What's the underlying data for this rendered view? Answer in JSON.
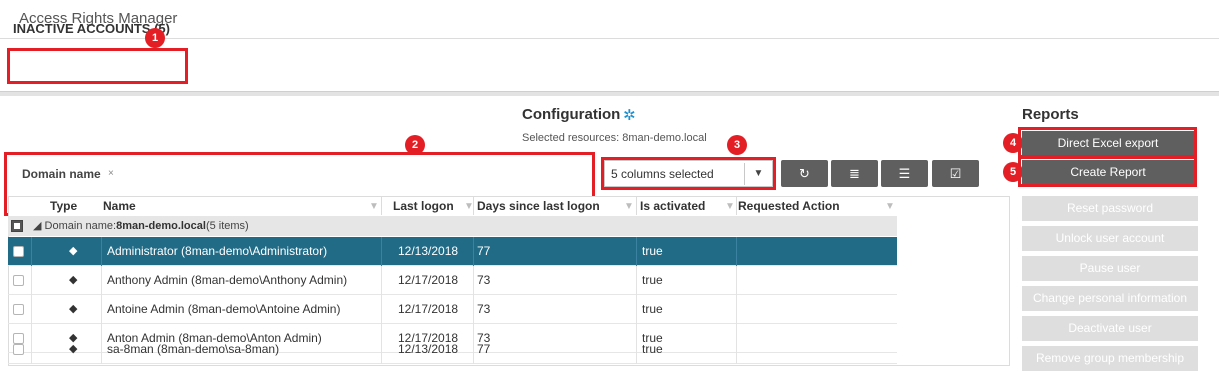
{
  "app": {
    "title": "Access Rights Manager"
  },
  "page": {
    "title": "INACTIVE ACCOUNTS (5)"
  },
  "badges": [
    "1",
    "2",
    "3",
    "4",
    "5"
  ],
  "configuration": {
    "title": "Configuration",
    "selected_resources": "Selected resources: 8man-demo.local",
    "gear_icon": "gear-icon"
  },
  "grouping": {
    "chip_label": "Domain name",
    "chip_remove": "×"
  },
  "columns_select": {
    "value": "5 columns selected",
    "caret": "▼"
  },
  "toolbar": [
    {
      "name": "refresh-icon",
      "glyph": "↻"
    },
    {
      "name": "list-icon",
      "glyph": "≣"
    },
    {
      "name": "align-icon",
      "glyph": "☰"
    },
    {
      "name": "check-square-icon",
      "glyph": "☑"
    }
  ],
  "reports": {
    "title": "Reports",
    "direct_excel_export": "Direct Excel export",
    "create_report": "Create Report"
  },
  "actions": [
    "Reset password",
    "Unlock user account",
    "Pause user",
    "Change personal information",
    "Deactivate user",
    "Remove group membership"
  ],
  "table": {
    "headers": {
      "type": "Type",
      "name": "Name",
      "last_logon": "Last logon",
      "days_since": "Days since last logon",
      "is_activated": "Is activated",
      "requested_action": "Requested Action"
    },
    "group": {
      "prefix": "Domain name:",
      "value": "8man-demo.local",
      "suffix": "(5 items)"
    },
    "rows": [
      {
        "name": "Administrator (8man-demo\\Administrator)",
        "last_logon": "12/13/2018",
        "days": "77",
        "activated": "true",
        "selected": true
      },
      {
        "name": "Anthony Admin (8man-demo\\Anthony Admin)",
        "last_logon": "12/17/2018",
        "days": "73",
        "activated": "true",
        "selected": false
      },
      {
        "name": "Antoine Admin (8man-demo\\Antoine Admin)",
        "last_logon": "12/17/2018",
        "days": "73",
        "activated": "true",
        "selected": false
      },
      {
        "name": "Anton Admin (8man-demo\\Anton Admin)",
        "last_logon": "12/17/2018",
        "days": "73",
        "activated": "true",
        "selected": false
      },
      {
        "name": "sa-8man (8man-demo\\sa-8man)",
        "last_logon": "12/13/2018",
        "days": "77",
        "activated": "true",
        "selected": false
      }
    ]
  },
  "colors": {
    "selected_row": "#226b86",
    "button": "#5f5f5f",
    "highlight": "#e31e24",
    "accent": "#1a8fd1"
  }
}
